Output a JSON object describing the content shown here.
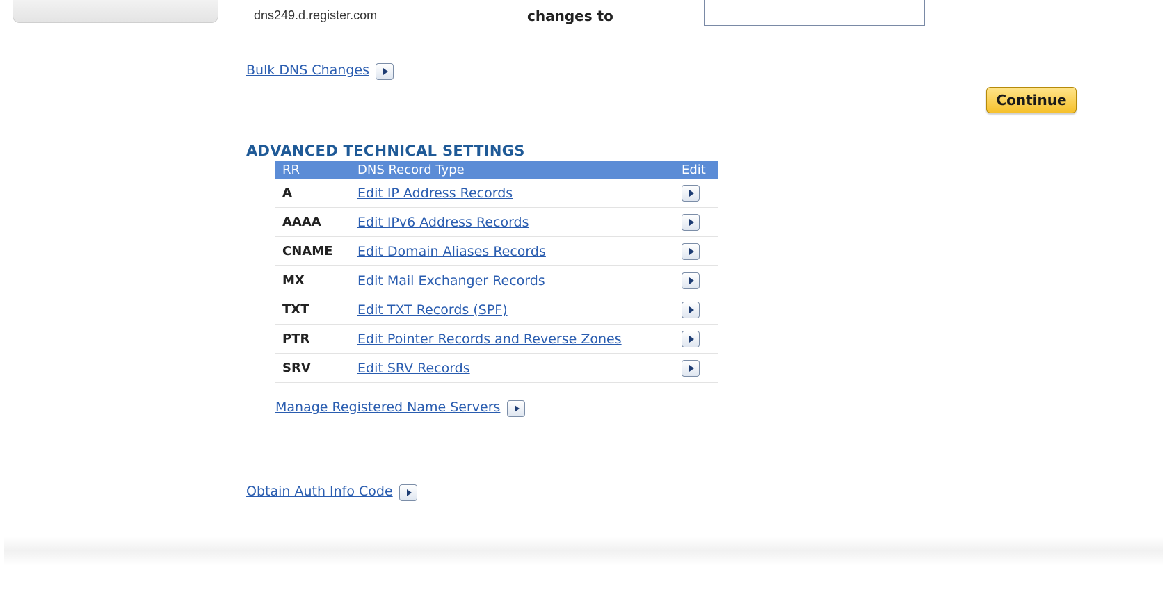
{
  "dns_row": {
    "server": "dns249.d.register.com",
    "changes_label": "changes to",
    "input_value": ""
  },
  "links": {
    "bulk_dns": "Bulk DNS Changes",
    "manage_ns": "Manage Registered Name Servers",
    "obtain_auth": "Obtain Auth Info Code"
  },
  "continue_label": "Continue",
  "advanced": {
    "title": "ADVANCED TECHNICAL SETTINGS",
    "headers": {
      "rr": "RR",
      "type": "DNS Record Type",
      "edit": "Edit"
    },
    "rows": [
      {
        "rr": "A",
        "label": "Edit IP Address Records"
      },
      {
        "rr": "AAAA",
        "label": "Edit IPv6 Address Records"
      },
      {
        "rr": "CNAME",
        "label": "Edit Domain Aliases Records"
      },
      {
        "rr": "MX",
        "label": "Edit Mail Exchanger Records"
      },
      {
        "rr": "TXT",
        "label": "Edit TXT Records (SPF)"
      },
      {
        "rr": "PTR",
        "label": "Edit Pointer Records and Reverse Zones"
      },
      {
        "rr": "SRV",
        "label": "Edit SRV Records"
      }
    ]
  },
  "colors": {
    "link": "#2a5db0",
    "table_header": "#5b8cd6",
    "section_title": "#1f5a97",
    "continue_button": "#f6c12c"
  },
  "icons": {
    "arrow": "arrow-right-icon"
  }
}
